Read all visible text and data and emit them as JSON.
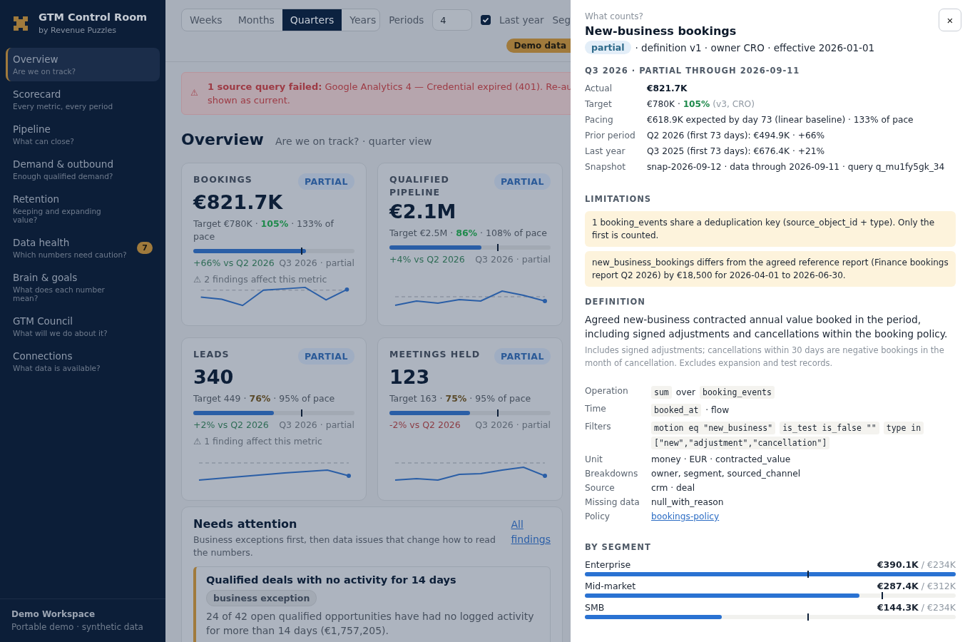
{
  "sidebar": {
    "brand": {
      "title": "GTM Control Room",
      "subtitle": "by Revenue Puzzles"
    },
    "items": [
      {
        "label": "Overview",
        "subtitle": "Are we on track?",
        "selected": true
      },
      {
        "label": "Scorecard",
        "subtitle": "Every metric, every period",
        "selected": false
      },
      {
        "label": "Pipeline",
        "subtitle": "What can close?",
        "selected": false
      },
      {
        "label": "Demand & outbound",
        "subtitle": "Enough qualified demand?",
        "selected": false
      },
      {
        "label": "Retention",
        "subtitle": "Keeping and expanding value?",
        "selected": false
      },
      {
        "label": "Data health",
        "subtitle": "Which numbers need caution?",
        "selected": false,
        "badge": "7"
      },
      {
        "label": "Brain & goals",
        "subtitle": "What does each number mean?",
        "selected": false
      },
      {
        "label": "GTM Council",
        "subtitle": "What will we do about it?",
        "selected": false
      },
      {
        "label": "Connections",
        "subtitle": "What data is available?",
        "selected": false
      }
    ],
    "footer": {
      "title": "Demo Workspace",
      "subtitle": "Portable demo · synthetic data"
    }
  },
  "toolbar": {
    "granularity": [
      {
        "label": "Weeks",
        "selected": false
      },
      {
        "label": "Months",
        "selected": false
      },
      {
        "label": "Quarters",
        "selected": true
      },
      {
        "label": "Years",
        "selected": false
      }
    ],
    "periods": {
      "label": "Periods",
      "value": "4"
    },
    "last_year": {
      "label": "Last year",
      "checked": true
    },
    "segment_label": "Seg",
    "demo_badge": "Demo data"
  },
  "alert": {
    "icon": "⚠",
    "lines": [
      "**1 source query failed:** Google Analytics 4 — Credential expired (401). Re-au",
      "shown as current."
    ]
  },
  "page": {
    "title": "Overview",
    "subtitle": "Are we on track? · quarter view"
  },
  "cards": [
    {
      "label": "BOOKINGS",
      "badge": "PARTIAL",
      "value": "€821.7K",
      "target": [
        {
          "kind": "plain",
          "text": "Target €780K · "
        },
        {
          "kind": "good",
          "text": "105%"
        },
        {
          "kind": "plain",
          "text": " · 133% of pace"
        }
      ],
      "level": 0.7,
      "target_marker": {
        "level": 0.67
      },
      "delta": {
        "text": "+66% vs Q2 2026",
        "positive": true
      },
      "period": "Q3 2026 · partial",
      "finding": "⚠ 2 findings affect this metric"
    },
    {
      "label": "QUALIFIED PIPELINE",
      "badge": "PARTIAL",
      "value": "€2.1M",
      "target": [
        {
          "kind": "plain",
          "text": "Target €2.5M · "
        },
        {
          "kind": "good",
          "text": "86%"
        },
        {
          "kind": "plain",
          "text": " · 108% of pace"
        }
      ],
      "level": 0.57,
      "target_marker": {
        "level": 0.67
      },
      "delta": {
        "text": "+4% vs Q2 2026",
        "positive": true
      },
      "period": "Q3 2026 · partial"
    },
    {
      "label": "LEADS",
      "badge": "PARTIAL",
      "value": "340",
      "target": [
        {
          "kind": "plain",
          "text": "Target 449 · "
        },
        {
          "kind": "warn",
          "text": "76%"
        },
        {
          "kind": "plain",
          "text": " · 95% of pace"
        }
      ],
      "level": 0.5,
      "target_marker": {
        "level": 0.67
      },
      "delta": {
        "text": "+2% vs Q2 2026",
        "positive": true
      },
      "period": "Q3 2026 · partial",
      "finding": "⚠ 1 finding affect this metric"
    },
    {
      "label": "MEETINGS HELD",
      "badge": "PARTIAL",
      "value": "123",
      "target": [
        {
          "kind": "plain",
          "text": "Target 163 · "
        },
        {
          "kind": "warn",
          "text": "75%"
        },
        {
          "kind": "plain",
          "text": " · 95% of pace"
        }
      ],
      "level": 0.5,
      "target_marker": {
        "level": 0.67
      },
      "delta": {
        "text": "-2% vs Q2 2026",
        "positive": false
      },
      "period": "Q3 2026 · partial"
    }
  ],
  "attention": {
    "title": "Needs attention",
    "subtitle": "Business exceptions first, then data issues that change how to read the numbers.",
    "link": "All findings",
    "findings": [
      {
        "title": "Qualified deals with no activity for 14 days",
        "tag": "business exception",
        "text": "24 of 42 open qualified opportunities have had no logged activity for more than 14 days (€1,757,205)."
      }
    ]
  },
  "drawer": {
    "eyebrow": "What counts?",
    "title": "New-business bookings",
    "badge": "partial",
    "meta": "· definition v1 · owner CRO · effective 2026-01-01",
    "close": "×",
    "period": "Q3 2026 · PARTIAL THROUGH 2026-09-11",
    "facts": [
      {
        "label": "Actual",
        "parts": [
          {
            "kind": "strong",
            "text": "€821.7K"
          }
        ]
      },
      {
        "label": "Target",
        "parts": [
          {
            "kind": "plain",
            "text": "€780K · "
          },
          {
            "kind": "good",
            "text": "105%"
          },
          {
            "kind": "muted",
            "text": " (v3, CRO)"
          }
        ]
      },
      {
        "label": "Pacing",
        "parts": [
          {
            "kind": "plain",
            "text": "€618.9K expected by day 73 (linear baseline) · 133% of pace"
          }
        ]
      },
      {
        "label": "Prior period",
        "parts": [
          {
            "kind": "plain",
            "text": "Q2 2026 (first 73 days): €494.9K · +66%"
          }
        ]
      },
      {
        "label": "Last year",
        "parts": [
          {
            "kind": "plain",
            "text": "Q3 2025 (first 73 days): €676.4K · +21%"
          }
        ]
      },
      {
        "label": "Snapshot",
        "parts": [
          {
            "kind": "plain",
            "text": "snap-2026-09-12 · data through 2026-09-11 · query q_mu1fy5gk_34"
          }
        ]
      }
    ],
    "limitations_heading": "LIMITATIONS",
    "limitations": [
      "1 booking_events share a deduplication key (source_object_id + type). Only the first is counted.",
      "new_business_bookings differs from the agreed reference report (Finance bookings report Q2 2026) by €18,500 for 2026-04-01 to 2026-06-30."
    ],
    "definition_heading": "DEFINITION",
    "definition": "Agreed new-business contracted annual value booked in the period, including signed adjustments and cancellations within the booking policy.",
    "definition_note": "Includes signed adjustments; cancellations within 30 days are negative bookings in the month of cancellation. Excludes expansion and test records.",
    "rows": [
      {
        "label": "Operation",
        "parts": [
          {
            "kind": "code",
            "text": "sum"
          },
          {
            "kind": "plain",
            "text": "over"
          },
          {
            "kind": "code",
            "text": "booking_events"
          }
        ]
      },
      {
        "label": "Time",
        "parts": [
          {
            "kind": "code",
            "text": "booked_at"
          },
          {
            "kind": "plain",
            "text": "· flow"
          }
        ]
      },
      {
        "label": "Filters",
        "parts": [
          {
            "kind": "code",
            "text": "motion eq \"new_business\""
          },
          {
            "kind": "code",
            "text": "is_test is_false \"\""
          },
          {
            "kind": "code",
            "text": "type in [\"new\",\"adjustment\",\"cancellation\"]"
          }
        ]
      },
      {
        "label": "Unit",
        "parts": [
          {
            "kind": "plain",
            "text": "money · EUR · contracted_value"
          }
        ]
      },
      {
        "label": "Breakdowns",
        "parts": [
          {
            "kind": "plain",
            "text": "owner, segment, sourced_channel"
          }
        ]
      },
      {
        "label": "Source",
        "parts": [
          {
            "kind": "plain",
            "text": "crm · deal"
          }
        ]
      },
      {
        "label": "Missing data",
        "parts": [
          {
            "kind": "plain",
            "text": "null_with_reason"
          }
        ]
      },
      {
        "label": "Policy",
        "parts": [
          {
            "kind": "link",
            "text": "bookings-policy"
          }
        ]
      }
    ],
    "segment_heading": "BY SEGMENT",
    "segments": [
      {
        "name": "Enterprise",
        "actual": "€390.1K",
        "target": "/ €234K",
        "level": 1,
        "target_marker": {
          "level": 0.6
        }
      },
      {
        "name": "Mid-market",
        "actual": "€287.4K",
        "target": "/ €312K",
        "level": 0.74,
        "target_marker": {
          "level": 0.8
        }
      },
      {
        "name": "SMB",
        "actual": "€144.3K",
        "target": "/ €234K",
        "level": 0.37,
        "target_marker": {
          "level": 0.6
        }
      }
    ]
  }
}
